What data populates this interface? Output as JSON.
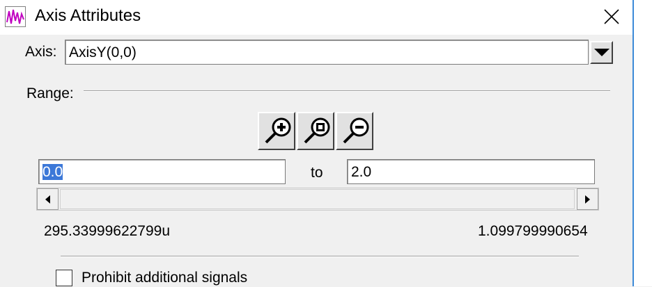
{
  "window": {
    "title": "Axis Attributes",
    "icon": "signal-waveform-icon",
    "close_icon": "close-icon"
  },
  "axis": {
    "label": "Axis:",
    "value": "AxisY(0,0)"
  },
  "range": {
    "label": "Range:",
    "zoom_buttons": [
      "zoom-in-icon",
      "zoom-fit-icon",
      "zoom-out-icon"
    ],
    "from_value": "0.0",
    "to_label": "to",
    "to_value": "2.0",
    "min_readout": "295.33999622799u",
    "max_readout": "1.099799990654"
  },
  "options": {
    "prohibit_label": "Prohibit additional signals",
    "prohibit_checked": false
  }
}
